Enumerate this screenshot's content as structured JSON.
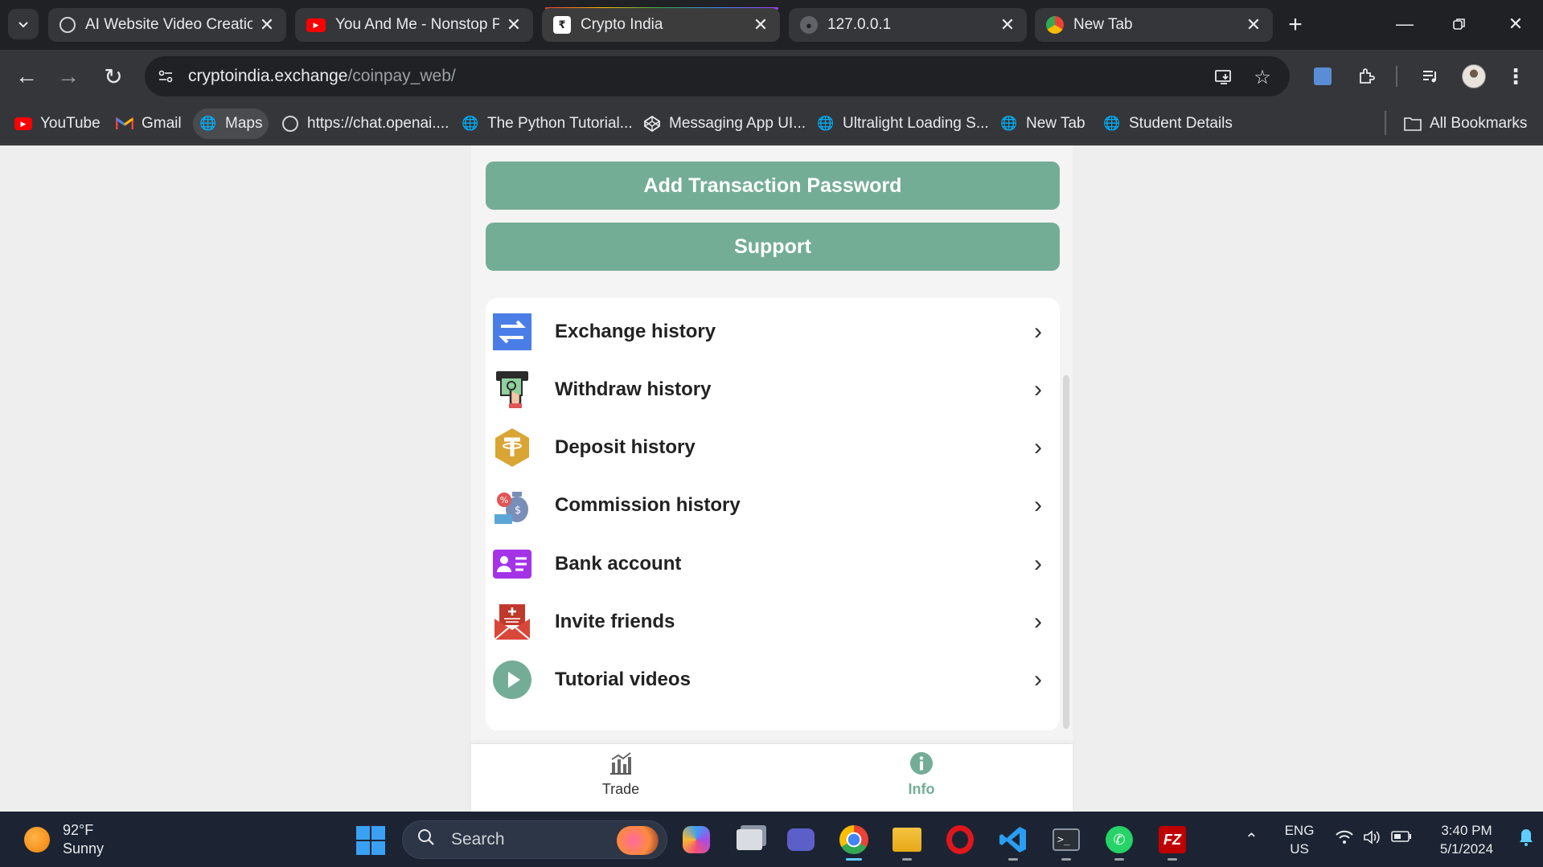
{
  "browser": {
    "tabs": [
      {
        "title": "AI Website Video Creatio",
        "favicon": "chatgpt-icon",
        "active": false
      },
      {
        "title": "You And Me - Nonstop P",
        "favicon": "youtube-icon",
        "active": false
      },
      {
        "title": "Crypto India",
        "favicon": "rupee-icon",
        "active": true
      },
      {
        "title": "127.0.0.1",
        "favicon": "globe-icon",
        "active": false
      },
      {
        "title": "New Tab",
        "favicon": "chrome-icon",
        "active": false
      }
    ],
    "url_host": "cryptoindia.exchange",
    "url_path": "/coinpay_web/",
    "bookmarks": [
      {
        "label": "YouTube",
        "icon": "youtube-icon"
      },
      {
        "label": "Gmail",
        "icon": "gmail-icon"
      },
      {
        "label": "Maps",
        "icon": "globe-icon"
      },
      {
        "label": "https://chat.openai....",
        "icon": "chatgpt-icon"
      },
      {
        "label": "The Python Tutorial...",
        "icon": "globe-icon"
      },
      {
        "label": "Messaging App UI...",
        "icon": "codepen-icon"
      },
      {
        "label": "Ultralight Loading S...",
        "icon": "globe-icon"
      },
      {
        "label": "New Tab",
        "icon": "globe-icon"
      },
      {
        "label": "Student Details",
        "icon": "globe-icon"
      }
    ],
    "all_bookmarks": "All Bookmarks"
  },
  "app": {
    "add_password_label": "Add Transaction Password",
    "support_label": "Support",
    "menu": [
      {
        "label": "Exchange history",
        "icon": "exchange-arrows-icon"
      },
      {
        "label": "Withdraw history",
        "icon": "atm-withdraw-icon"
      },
      {
        "label": "Deposit history",
        "icon": "tether-coin-icon"
      },
      {
        "label": "Commission history",
        "icon": "money-bag-icon"
      },
      {
        "label": "Bank account",
        "icon": "id-card-icon"
      },
      {
        "label": "Invite friends",
        "icon": "invite-envelope-icon"
      },
      {
        "label": "Tutorial videos",
        "icon": "play-circle-icon"
      }
    ],
    "bottom_nav": [
      {
        "label": "Trade",
        "icon": "chart-icon",
        "active": false
      },
      {
        "label": "Info",
        "icon": "info-icon",
        "active": true
      }
    ],
    "colors": {
      "accent": "#74ad96",
      "exchange": "#4a7ee6",
      "deposit": "#d9a534",
      "bank": "#a433e8",
      "invite": "#c0392b"
    }
  },
  "taskbar": {
    "weather_temp": "92°F",
    "weather_desc": "Sunny",
    "search_placeholder": "Search",
    "lang_top": "ENG",
    "lang_bottom": "US",
    "time": "3:40 PM",
    "date": "5/1/2024"
  }
}
